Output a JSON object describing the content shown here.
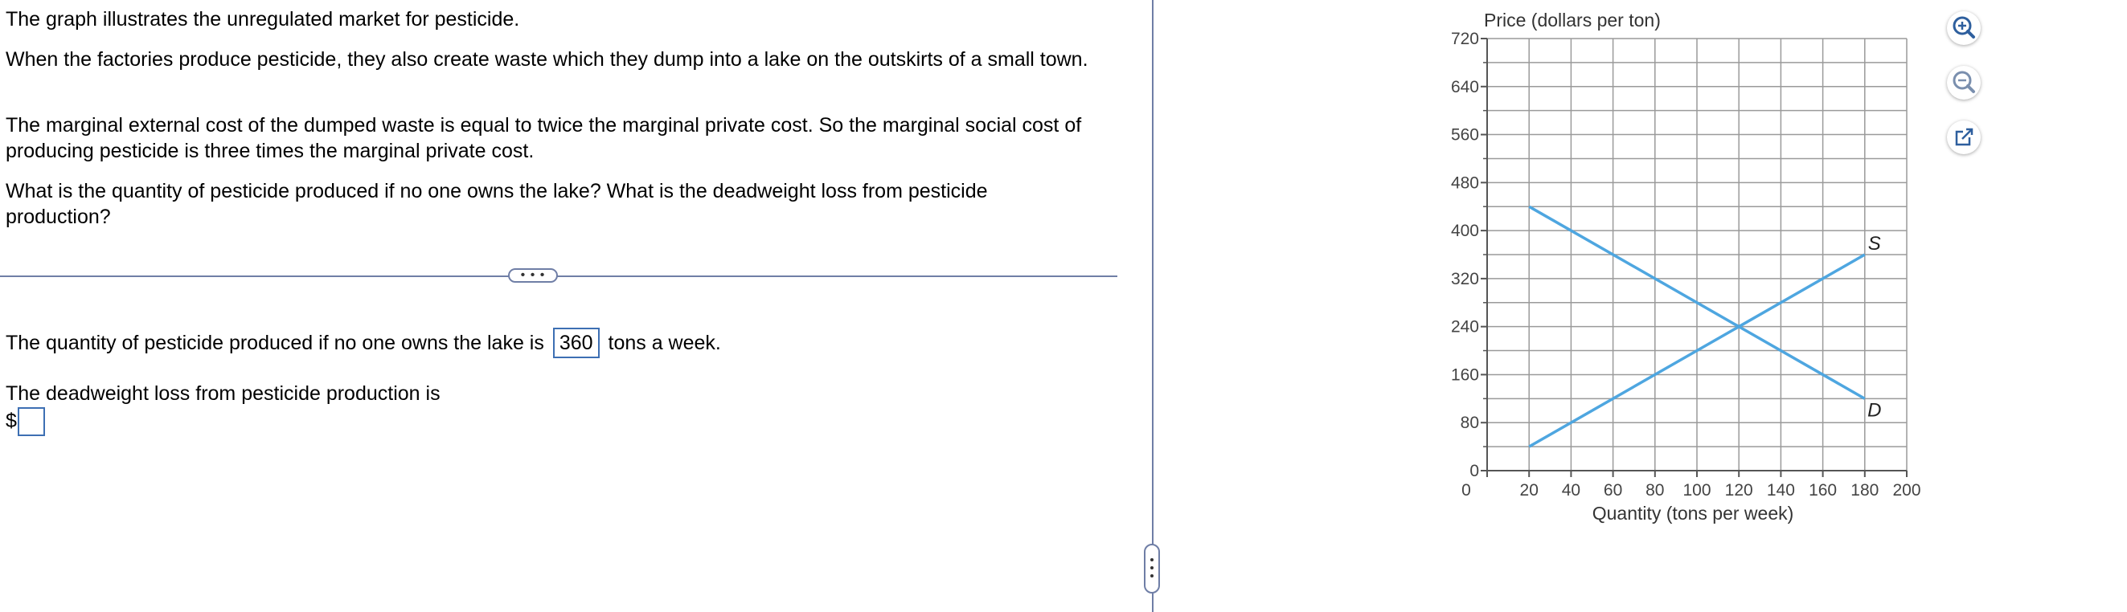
{
  "question": {
    "p1": "The graph illustrates the unregulated market for pesticide.",
    "p2": "When the factories produce pesticide, they also create waste which they dump into a lake on the outskirts of a small town.",
    "p3": "The marginal external cost of the dumped waste is equal to twice the marginal private cost. So the marginal social cost of producing pesticide is three times the marginal private cost.",
    "p4": "What is the quantity of pesticide produced if no one owns the lake? What is the deadweight loss from pesticide production?"
  },
  "expand_label": "• • •",
  "answer": {
    "qty_prefix": "The quantity of pesticide produced if no one owns the lake is",
    "qty_value": "360",
    "qty_suffix": "tons a week.",
    "dwl_label": "The deadweight loss from pesticide production is",
    "dwl_currency": "$",
    "dwl_value": ""
  },
  "tools": {
    "zoom_in": "zoom-in-icon",
    "zoom_out": "zoom-out-icon",
    "popout": "external-link-icon",
    "color": "#2e5f9e"
  },
  "chart_data": {
    "type": "line",
    "ylabel": "Price (dollars per ton)",
    "xlabel": "Quantity (tons per week)",
    "xlim": [
      0,
      200
    ],
    "ylim": [
      0,
      720
    ],
    "xticks": [
      "0",
      "20",
      "40",
      "60",
      "80",
      "100",
      "120",
      "140",
      "160",
      "180",
      "200"
    ],
    "yticks": [
      "0",
      "80",
      "160",
      "240",
      "320",
      "400",
      "480",
      "560",
      "640",
      "720"
    ],
    "grid": true,
    "line_color": "#4ea6e0",
    "series": [
      {
        "name": "S",
        "x": [
          20,
          180
        ],
        "y": [
          40,
          360
        ]
      },
      {
        "name": "D",
        "x": [
          20,
          180
        ],
        "y": [
          440,
          120
        ]
      }
    ]
  }
}
